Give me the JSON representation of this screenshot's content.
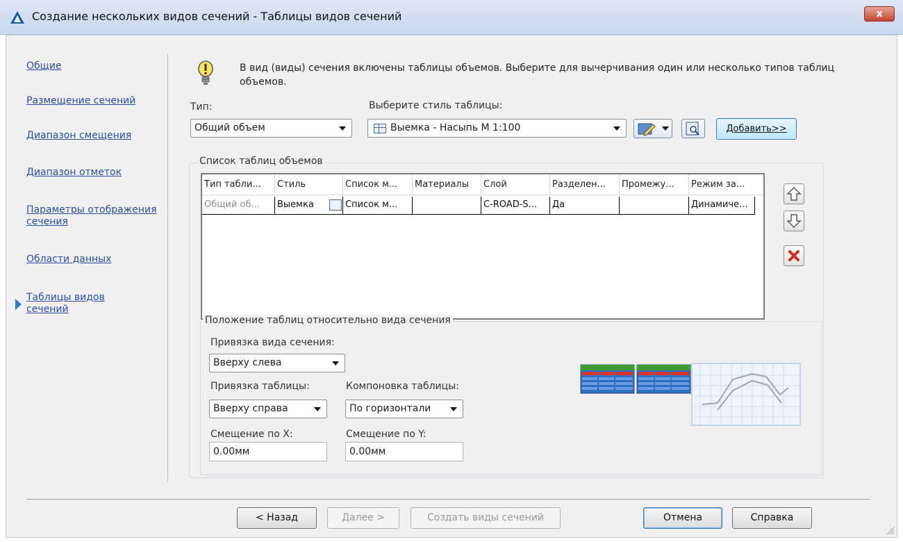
{
  "window": {
    "title": "Создание нескольких видов сечений - Таблицы видов сечений",
    "close_label": "x"
  },
  "nav": {
    "items": [
      {
        "label": "Общие"
      },
      {
        "label": "Размещение сечений"
      },
      {
        "label": "Диапазон смещения"
      },
      {
        "label": "Диапазон отметок"
      },
      {
        "label": "Параметры отображения сечения"
      },
      {
        "label": "Области данных"
      },
      {
        "label": "Таблицы видов сечений",
        "active": true
      }
    ]
  },
  "hint": {
    "text": "В вид (виды) сечения включены таблицы объемов. Выберите для вычерчивания один или несколько типов таблиц объемов."
  },
  "type_select": {
    "label": "Тип:",
    "value": "Общий объем"
  },
  "style_select": {
    "label": "Выберите стиль таблицы:",
    "value": "Выемка - Насыпь М 1:100"
  },
  "add_button": {
    "label": "Добавить>>"
  },
  "tables_list": {
    "title": "Список таблиц объемов",
    "columns": [
      "Тип табли...",
      "Стиль",
      "Список м...",
      "Материалы",
      "Слой",
      "Разделен...",
      "Промежу...",
      "Режим за..."
    ],
    "rows": [
      {
        "cells": [
          "Общий об...",
          "Выемка",
          "Список м...",
          "",
          "C-ROAD-S...",
          "Да",
          "",
          "Динамиче..."
        ]
      }
    ]
  },
  "position_group": {
    "title": "Положение таблиц относительно вида сечения",
    "view_anchor": {
      "label": "Привязка вида сечения:",
      "value": "Вверху слева"
    },
    "table_anchor": {
      "label": "Привязка таблицы:",
      "value": "Вверху справа"
    },
    "table_layout": {
      "label": "Компоновка таблицы:",
      "value": "По горизонтали"
    },
    "offset_x": {
      "label": "Смещение по X:",
      "value": "0.00мм"
    },
    "offset_y": {
      "label": "Смещение по Y:",
      "value": "0.00мм"
    }
  },
  "footer": {
    "back": "< Назад",
    "next": "Далее >",
    "create": "Создать виды сечений",
    "cancel": "Отмена",
    "help": "Справка"
  },
  "colors": {
    "link": "#2a4f9c",
    "accent": "#2f79c8",
    "delete_red": "#d12b1f",
    "preview_green": "#3f9c35",
    "preview_red": "#d8342a",
    "preview_blue": "#2e6fc4"
  }
}
